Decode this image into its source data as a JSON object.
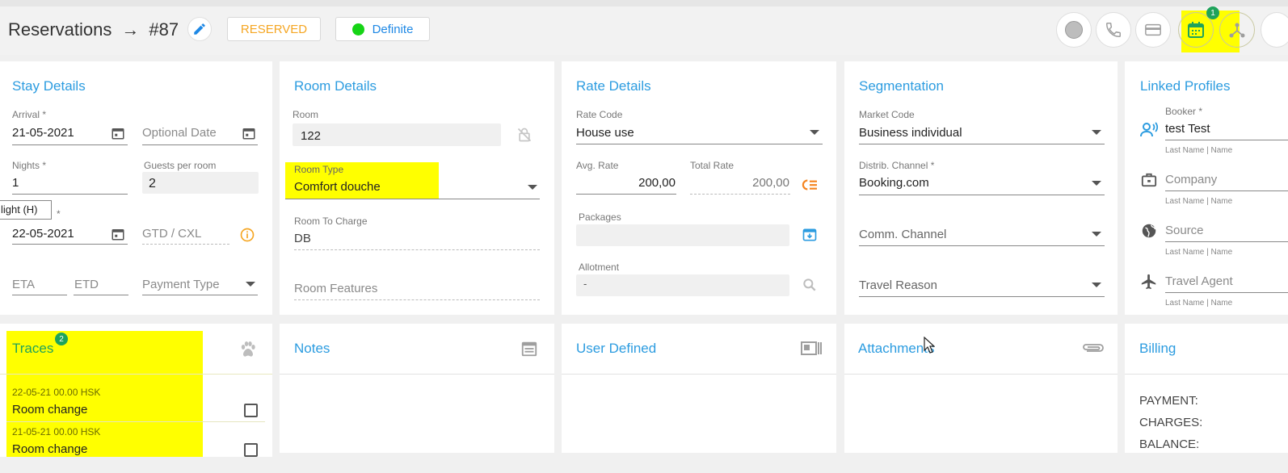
{
  "header": {
    "title": "Reservations",
    "reservation_number": "#87",
    "status": "RESERVED",
    "definite_label": "Definite",
    "calendar_badge": "1"
  },
  "tooltip": "light (H)",
  "stay": {
    "title": "Stay Details",
    "arrival_label": "Arrival *",
    "arrival_value": "21-05-2021",
    "optional_date_placeholder": "Optional Date",
    "nights_label": "Nights *",
    "nights_value": "1",
    "guests_label": "Guests per room",
    "guests_value": "2",
    "departure_label": "*",
    "departure_value": "22-05-2021",
    "gtd_placeholder": "GTD / CXL",
    "eta_placeholder": "ETA",
    "etd_placeholder": "ETD",
    "payment_type_placeholder": "Payment Type"
  },
  "room": {
    "title": "Room Details",
    "room_label": "Room",
    "room_value": "122",
    "room_type_label": "Room Type",
    "room_type_value": "Comfort douche",
    "room_to_charge_label": "Room To Charge",
    "room_to_charge_value": "DB",
    "room_features_placeholder": "Room Features"
  },
  "rate": {
    "title": "Rate Details",
    "rate_code_label": "Rate Code",
    "rate_code_value": "House use",
    "avg_rate_label": "Avg. Rate",
    "avg_rate_value": "200,00",
    "total_rate_label": "Total Rate",
    "total_rate_value": "200,00",
    "packages_label": "Packages",
    "allotment_label": "Allotment",
    "allotment_value": "-"
  },
  "segmentation": {
    "title": "Segmentation",
    "market_code_label": "Market Code",
    "market_code_value": "Business individual",
    "distrib_label": "Distrib. Channel *",
    "distrib_value": "Booking.com",
    "comm_channel_placeholder": "Comm. Channel",
    "travel_reason_placeholder": "Travel Reason"
  },
  "linked": {
    "title": "Linked Profiles",
    "booker_label": "Booker *",
    "booker_value": "test Test",
    "company_placeholder": "Company",
    "source_placeholder": "Source",
    "travel_agent_placeholder": "Travel Agent",
    "hint": "Last Name | Name"
  },
  "traces": {
    "title": "Traces",
    "badge": "2",
    "items": [
      {
        "meta": "22-05-21 00.00 HSK",
        "text": "Room change"
      },
      {
        "meta": "21-05-21 00.00 HSK",
        "text": "Room change"
      }
    ]
  },
  "notes": {
    "title": "Notes"
  },
  "user_defined": {
    "title": "User Defined"
  },
  "attachments": {
    "title": "Attachments"
  },
  "billing": {
    "title": "Billing",
    "payment": "PAYMENT:",
    "charges": "CHARGES:",
    "balance": "BALANCE:"
  }
}
